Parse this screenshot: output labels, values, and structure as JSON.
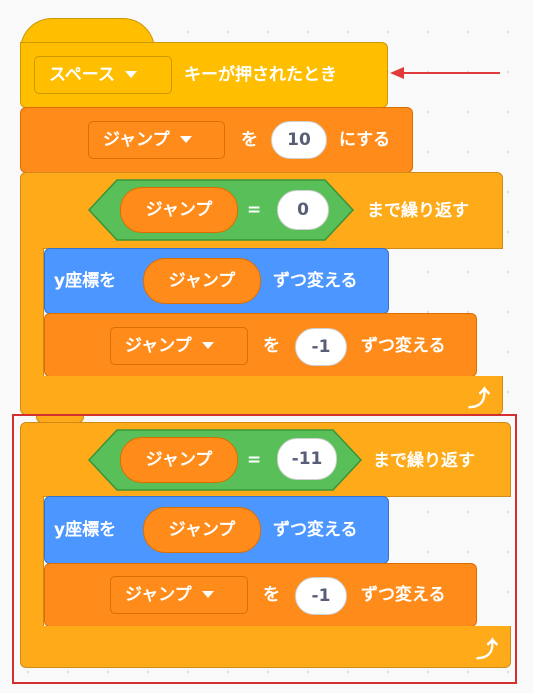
{
  "hat": {
    "key": "スペース",
    "label": "キーが押されたとき"
  },
  "set_block": {
    "variable": "ジャンプ",
    "to": "を",
    "value": "10",
    "suffix": "にする"
  },
  "loop1": {
    "cond_left": "ジャンプ",
    "op": "=",
    "cond_right": "0",
    "label": "まで繰り返す",
    "move": {
      "label": "y座標を",
      "reporter": "ジャンプ",
      "suffix": "ずつ変える"
    },
    "change": {
      "variable": "ジャンプ",
      "to": "を",
      "value": "-1",
      "suffix": "ずつ変える"
    },
    "loop_icon": "loop-arrow-icon"
  },
  "loop2": {
    "cond_left": "ジャンプ",
    "op": "=",
    "cond_right": "-11",
    "label": "まで繰り返す",
    "move": {
      "label": "y座標を",
      "reporter": "ジャンプ",
      "suffix": "ずつ変える"
    },
    "change": {
      "variable": "ジャンプ",
      "to": "を",
      "value": "-1",
      "suffix": "ずつ変える"
    },
    "loop_icon": "loop-arrow-icon"
  },
  "annotations": {
    "arrow_color": "#e03a3a",
    "highlight_color": "#d32f2f"
  }
}
